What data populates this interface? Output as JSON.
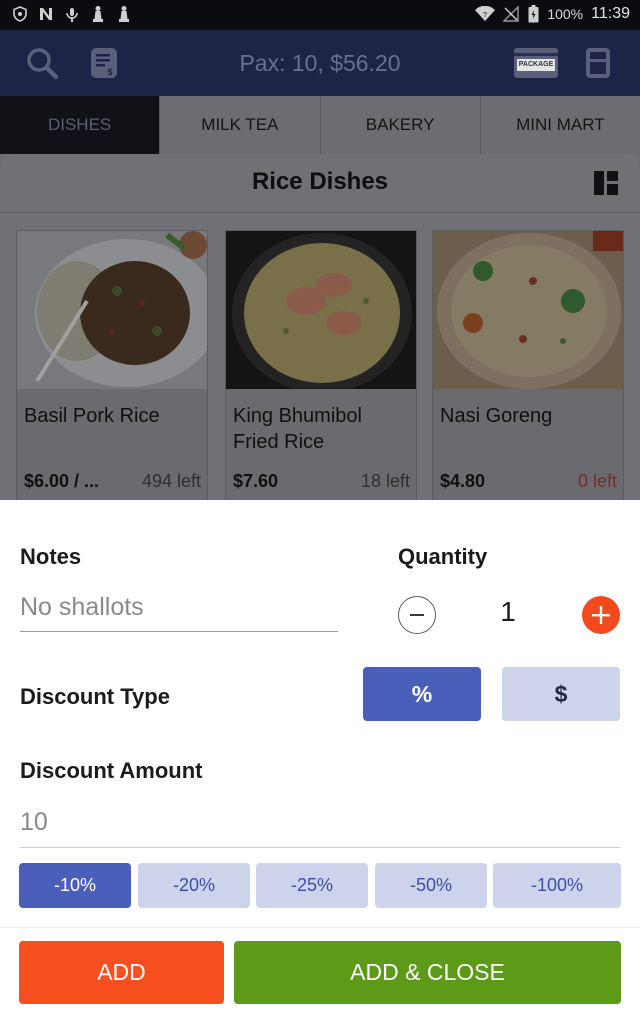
{
  "status_bar": {
    "battery": "100%",
    "time": "11:39",
    "left_icons": [
      "shield-icon",
      "n-icon",
      "antenna-icon",
      "chess-icon",
      "chess-icon"
    ],
    "right_icons": [
      "wifi-icon",
      "no-signal-icon",
      "battery-icon"
    ]
  },
  "app_bar": {
    "title": "Pax: 10, $56.20",
    "package_label": "PACKAGE",
    "icons": [
      "search-icon",
      "bill-icon",
      "package-icon",
      "calculator-icon"
    ]
  },
  "tabs": [
    {
      "label": "DISHES",
      "active": true
    },
    {
      "label": "MILK TEA",
      "active": false
    },
    {
      "label": "BAKERY",
      "active": false
    },
    {
      "label": "MINI MART",
      "active": false
    }
  ],
  "category": {
    "title": "Rice Dishes",
    "items": [
      {
        "name": "Basil Pork Rice",
        "price": "$6.00 / ...",
        "stock": "494 left"
      },
      {
        "name": "King Bhumibol Fried Rice",
        "price": "$7.60",
        "stock": "18 left"
      },
      {
        "name": "Nasi Goreng",
        "price": "$4.80",
        "stock": "0 left"
      }
    ]
  },
  "dialog": {
    "notes_label": "Notes",
    "notes_placeholder": "No shallots",
    "quantity_label": "Quantity",
    "quantity_value": "1",
    "discount_type_label": "Discount Type",
    "discount_types": [
      {
        "label": "%",
        "selected": true
      },
      {
        "label": "$",
        "selected": false
      }
    ],
    "discount_amount_label": "Discount Amount",
    "discount_amount_value": "10",
    "presets": [
      {
        "label": "-10%",
        "selected": true
      },
      {
        "label": "-20%",
        "selected": false
      },
      {
        "label": "-25%",
        "selected": false
      },
      {
        "label": "-50%",
        "selected": false
      },
      {
        "label": "-100%",
        "selected": false
      }
    ],
    "add_label": "ADD",
    "add_close_label": "ADD & CLOSE"
  },
  "colors": {
    "app_bar": "#1d2447",
    "primary": "#4a5fba",
    "primary_light": "#cdd3eb",
    "add": "#f84f21",
    "add_close": "#5c9a18",
    "out_of_stock": "#e53935"
  }
}
